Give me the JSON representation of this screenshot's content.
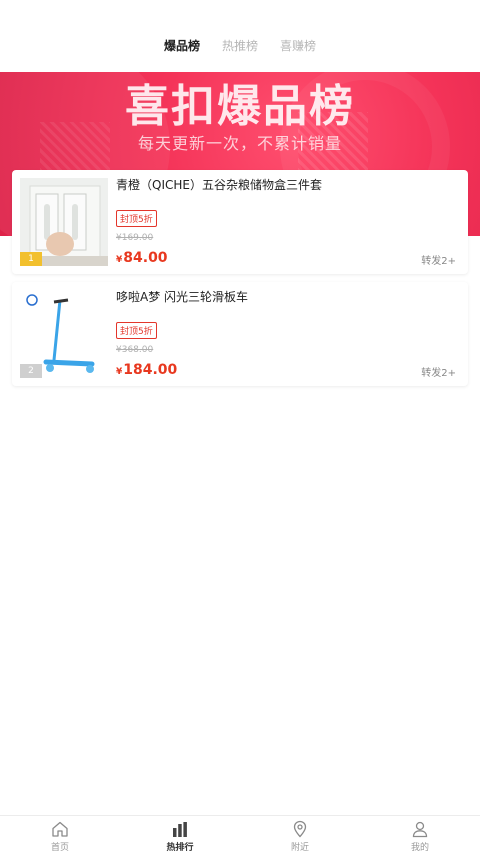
{
  "top_tabs": [
    {
      "label": "爆品榜",
      "active": true
    },
    {
      "label": "热推榜",
      "active": false
    },
    {
      "label": "喜赚榜",
      "active": false
    }
  ],
  "banner": {
    "title": "喜扣爆品榜",
    "subtitle": "每天更新一次，不累计销量",
    "color": "#f43358"
  },
  "products": [
    {
      "rank": "1",
      "title": "青橙（QICHE）五谷杂粮储物盒三件套",
      "badge": "封顶5折",
      "original_price": "¥169.00",
      "currency": "¥",
      "price": "84.00",
      "share": "转发2+"
    },
    {
      "rank": "2",
      "title": "哆啦A梦 闪光三轮滑板车",
      "badge": "封顶5折",
      "original_price": "¥368.00",
      "currency": "¥",
      "price": "184.00",
      "share": "转发2+"
    }
  ],
  "bottom_nav": [
    {
      "label": "首页",
      "icon": "home-icon",
      "active": false
    },
    {
      "label": "热排行",
      "icon": "bar-chart-icon",
      "active": true
    },
    {
      "label": "附近",
      "icon": "location-pin-icon",
      "active": false
    },
    {
      "label": "我的",
      "icon": "user-icon",
      "active": false
    }
  ],
  "colors": {
    "accent": "#e8381f",
    "rank_first": "#f2c02d",
    "rank_other": "#cfcfcf"
  }
}
